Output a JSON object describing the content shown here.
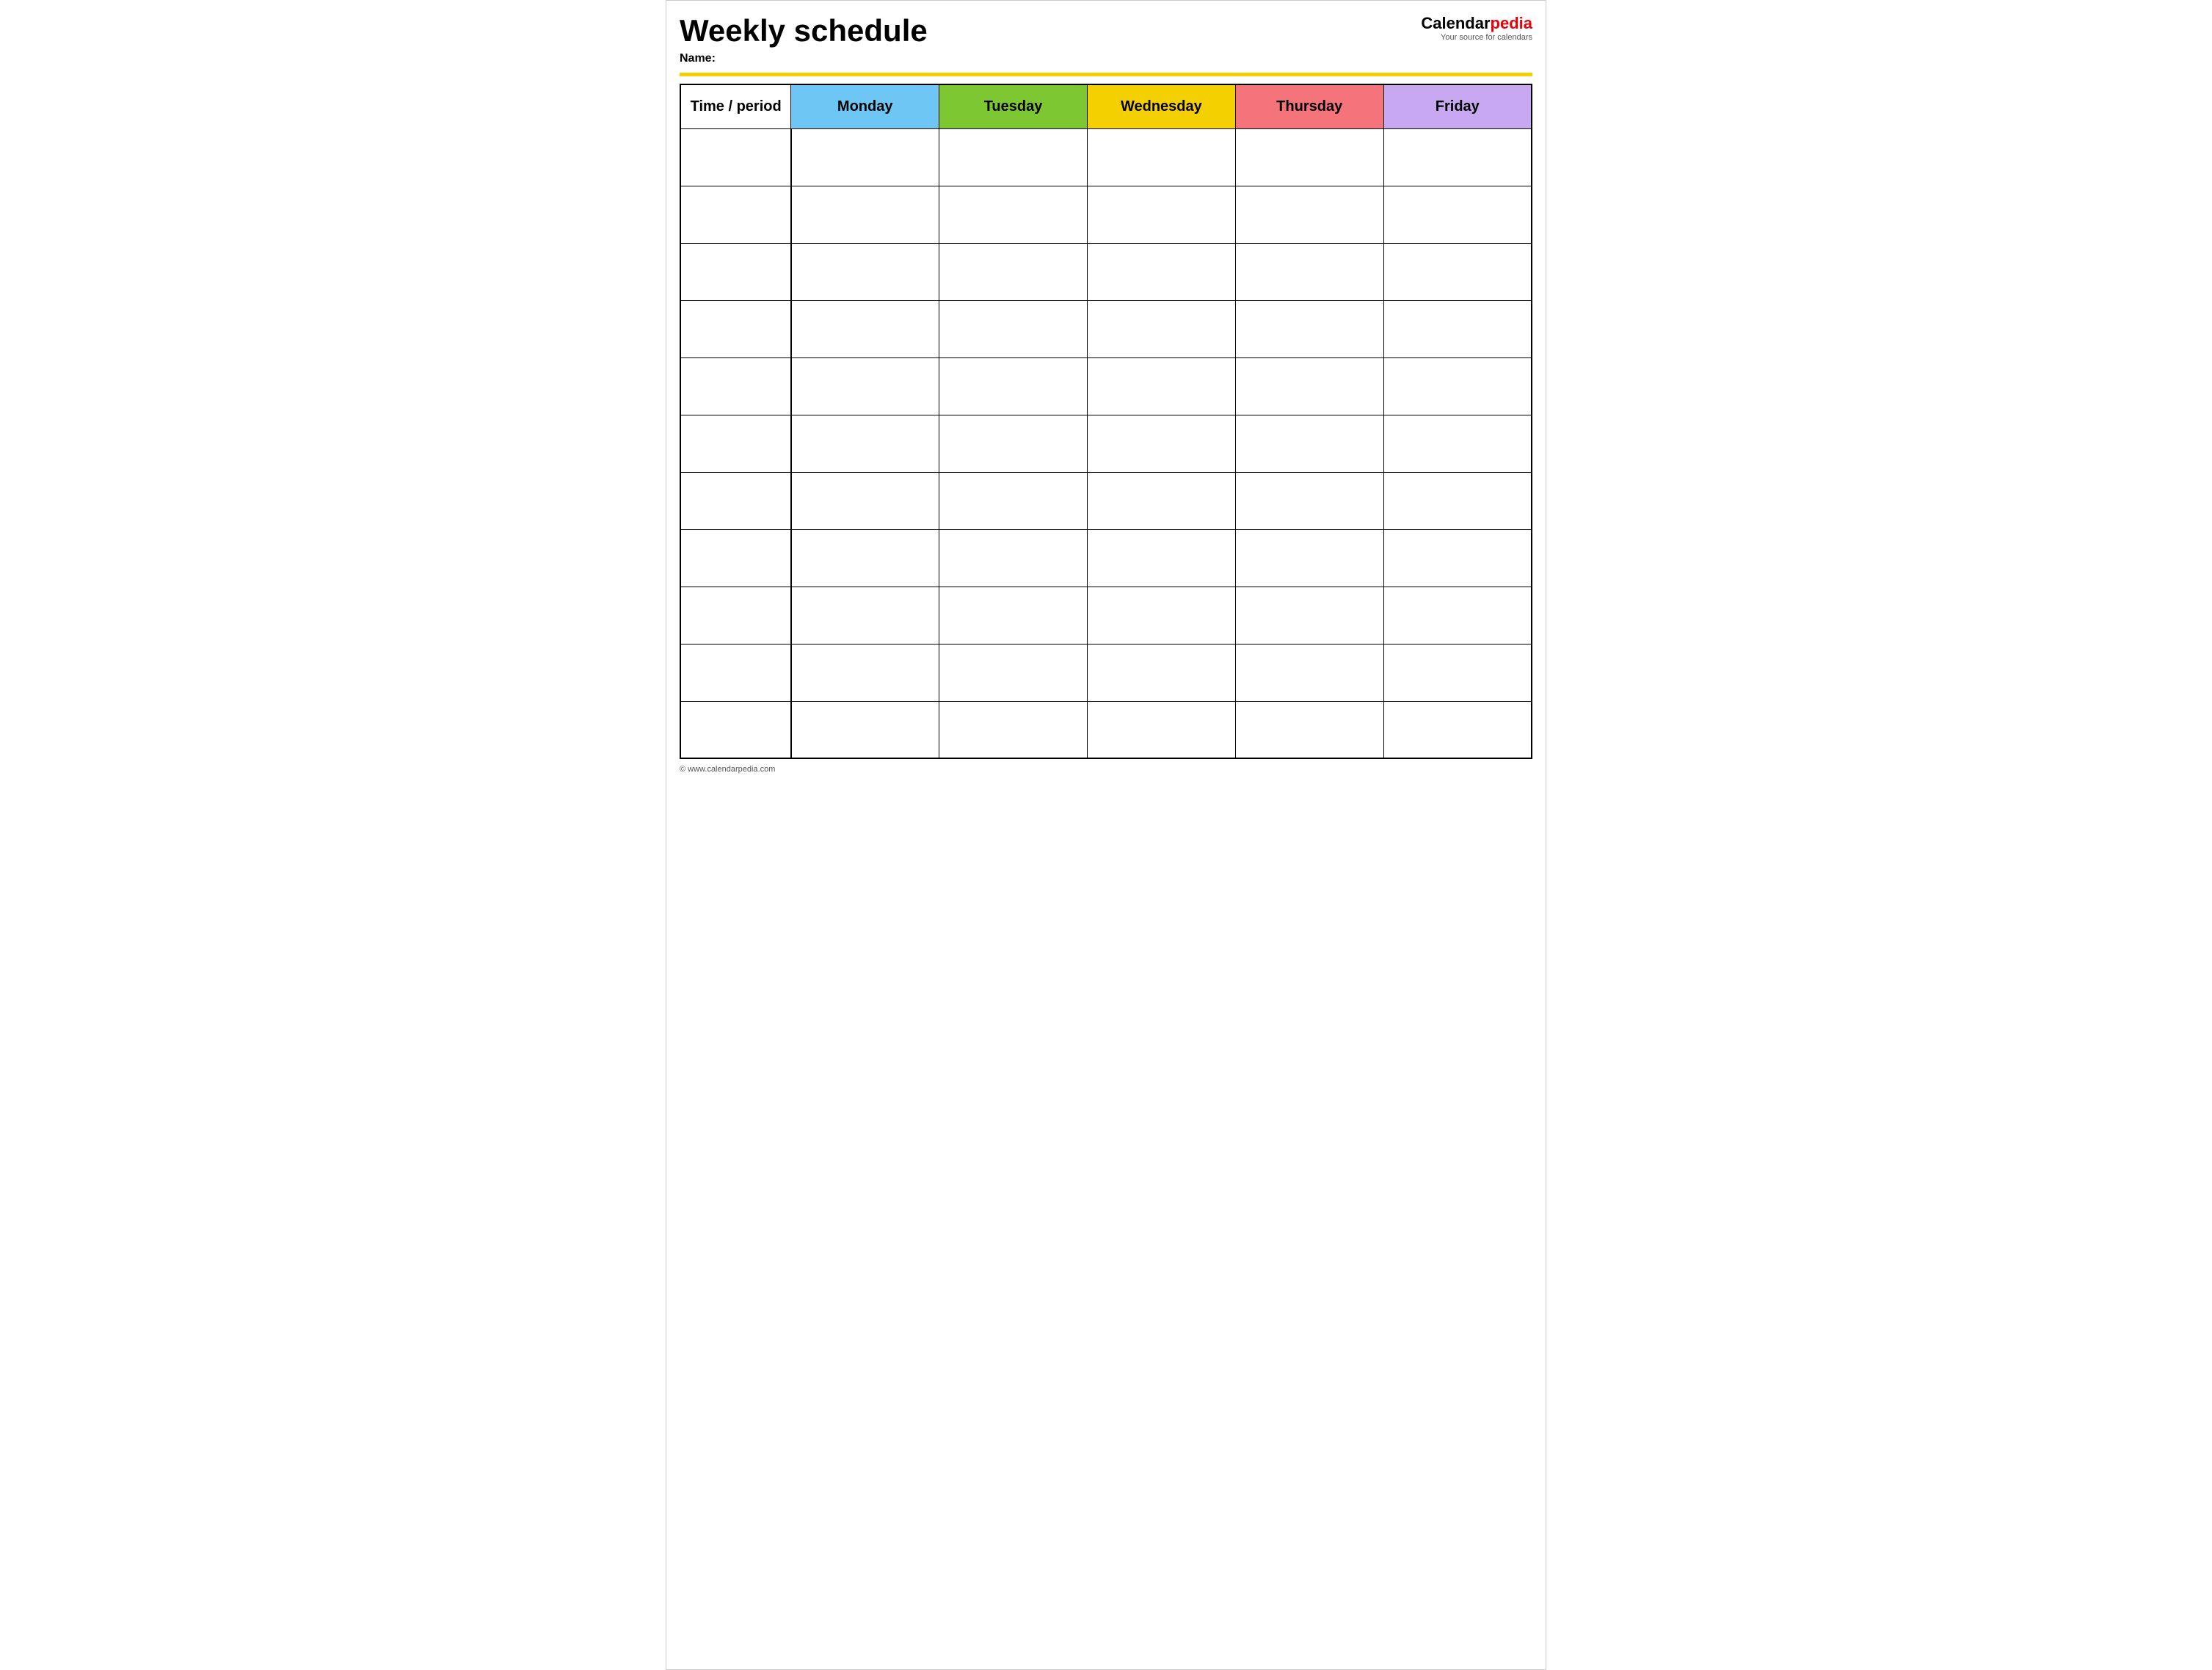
{
  "header": {
    "title": "Weekly schedule",
    "name_label": "Name:",
    "logo": {
      "calendar": "Calendar",
      "pedia": "pedia",
      "tagline": "Your source for calendars"
    }
  },
  "table": {
    "columns": [
      {
        "key": "time",
        "label": "Time / period",
        "color": "#ffffff"
      },
      {
        "key": "monday",
        "label": "Monday",
        "color": "#6ec6f5"
      },
      {
        "key": "tuesday",
        "label": "Tuesday",
        "color": "#7dc832"
      },
      {
        "key": "wednesday",
        "label": "Wednesday",
        "color": "#f5d000"
      },
      {
        "key": "thursday",
        "label": "Thursday",
        "color": "#f5737a"
      },
      {
        "key": "friday",
        "label": "Friday",
        "color": "#c8a8f0"
      }
    ],
    "row_count": 11
  },
  "footer": {
    "url": "© www.calendarpedia.com"
  }
}
